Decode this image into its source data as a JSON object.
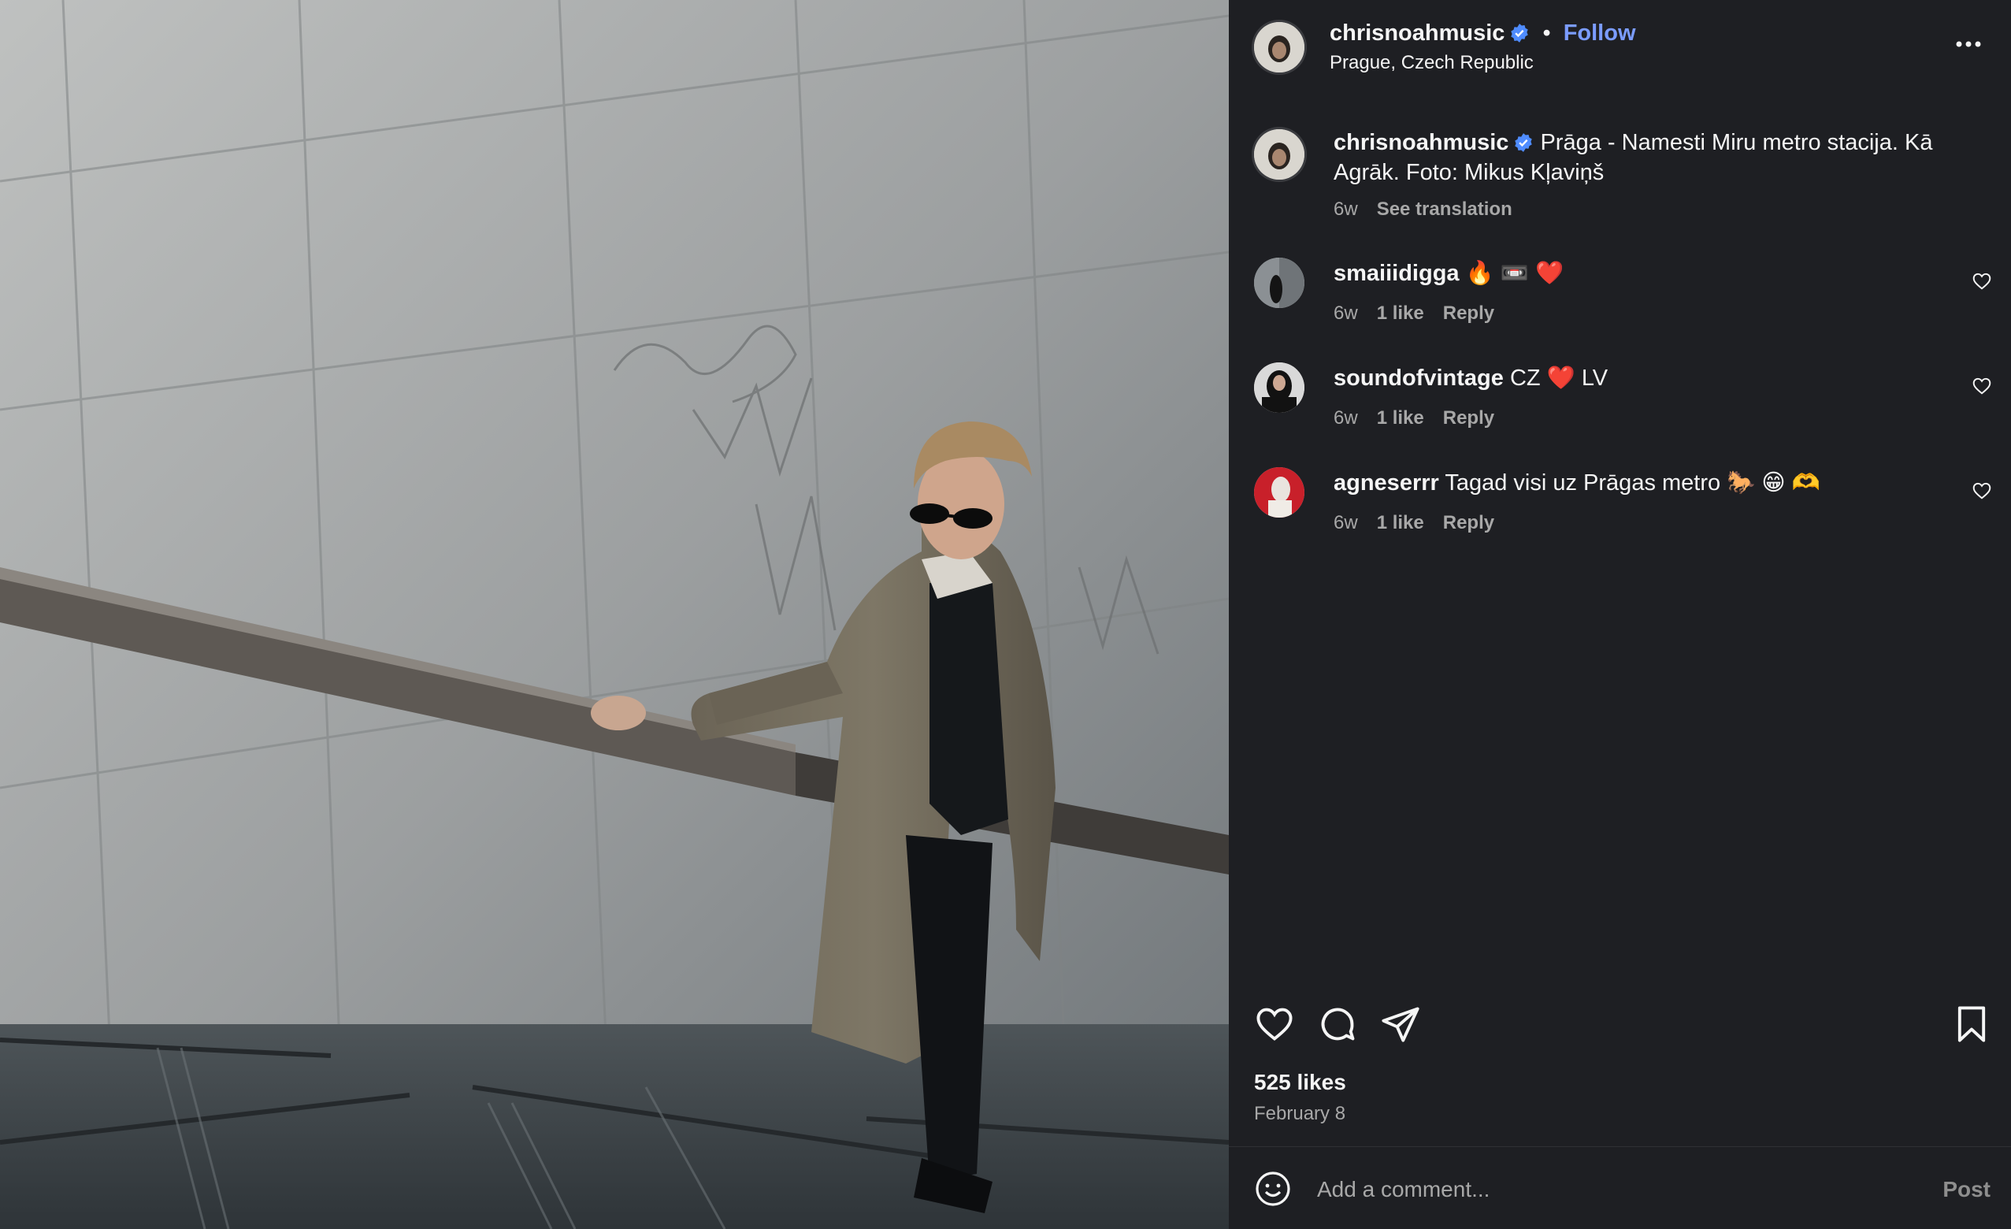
{
  "post": {
    "author": "chrisnoahmusic",
    "follow_label": "Follow",
    "dot": "•",
    "location": "Prague, Czech Republic",
    "caption": "Prāga - Namesti Miru metro stacija. Kā Agrāk. Foto: Mikus Kļaviņš",
    "caption_time": "6w",
    "see_translation": "See translation",
    "likes": "525 likes",
    "date": "February 8"
  },
  "comments": [
    {
      "user": "smaiiidigga",
      "text": "🔥 📼 ❤️",
      "time": "6w",
      "likes": "1 like",
      "reply": "Reply"
    },
    {
      "user": "soundofvintage",
      "text": "CZ ❤️ LV",
      "time": "6w",
      "likes": "1 like",
      "reply": "Reply"
    },
    {
      "user": "agneserrr",
      "text": "Tagad visi uz Prāgas metro 🐎 😁 🫶",
      "time": "6w",
      "likes": "1 like",
      "reply": "Reply"
    }
  ],
  "composer": {
    "placeholder": "Add a comment...",
    "post_label": "Post"
  },
  "icons": {
    "more": "more-options-icon",
    "like": "heart-icon",
    "comment": "comment-icon",
    "share": "share-icon",
    "save": "bookmark-icon",
    "emoji": "emoji-icon",
    "verified": "verified-badge-icon"
  },
  "colors": {
    "background": "#1e1f23",
    "accent": "#7b9cff",
    "verified": "#4f8cff",
    "muted": "#a8a8a8"
  }
}
